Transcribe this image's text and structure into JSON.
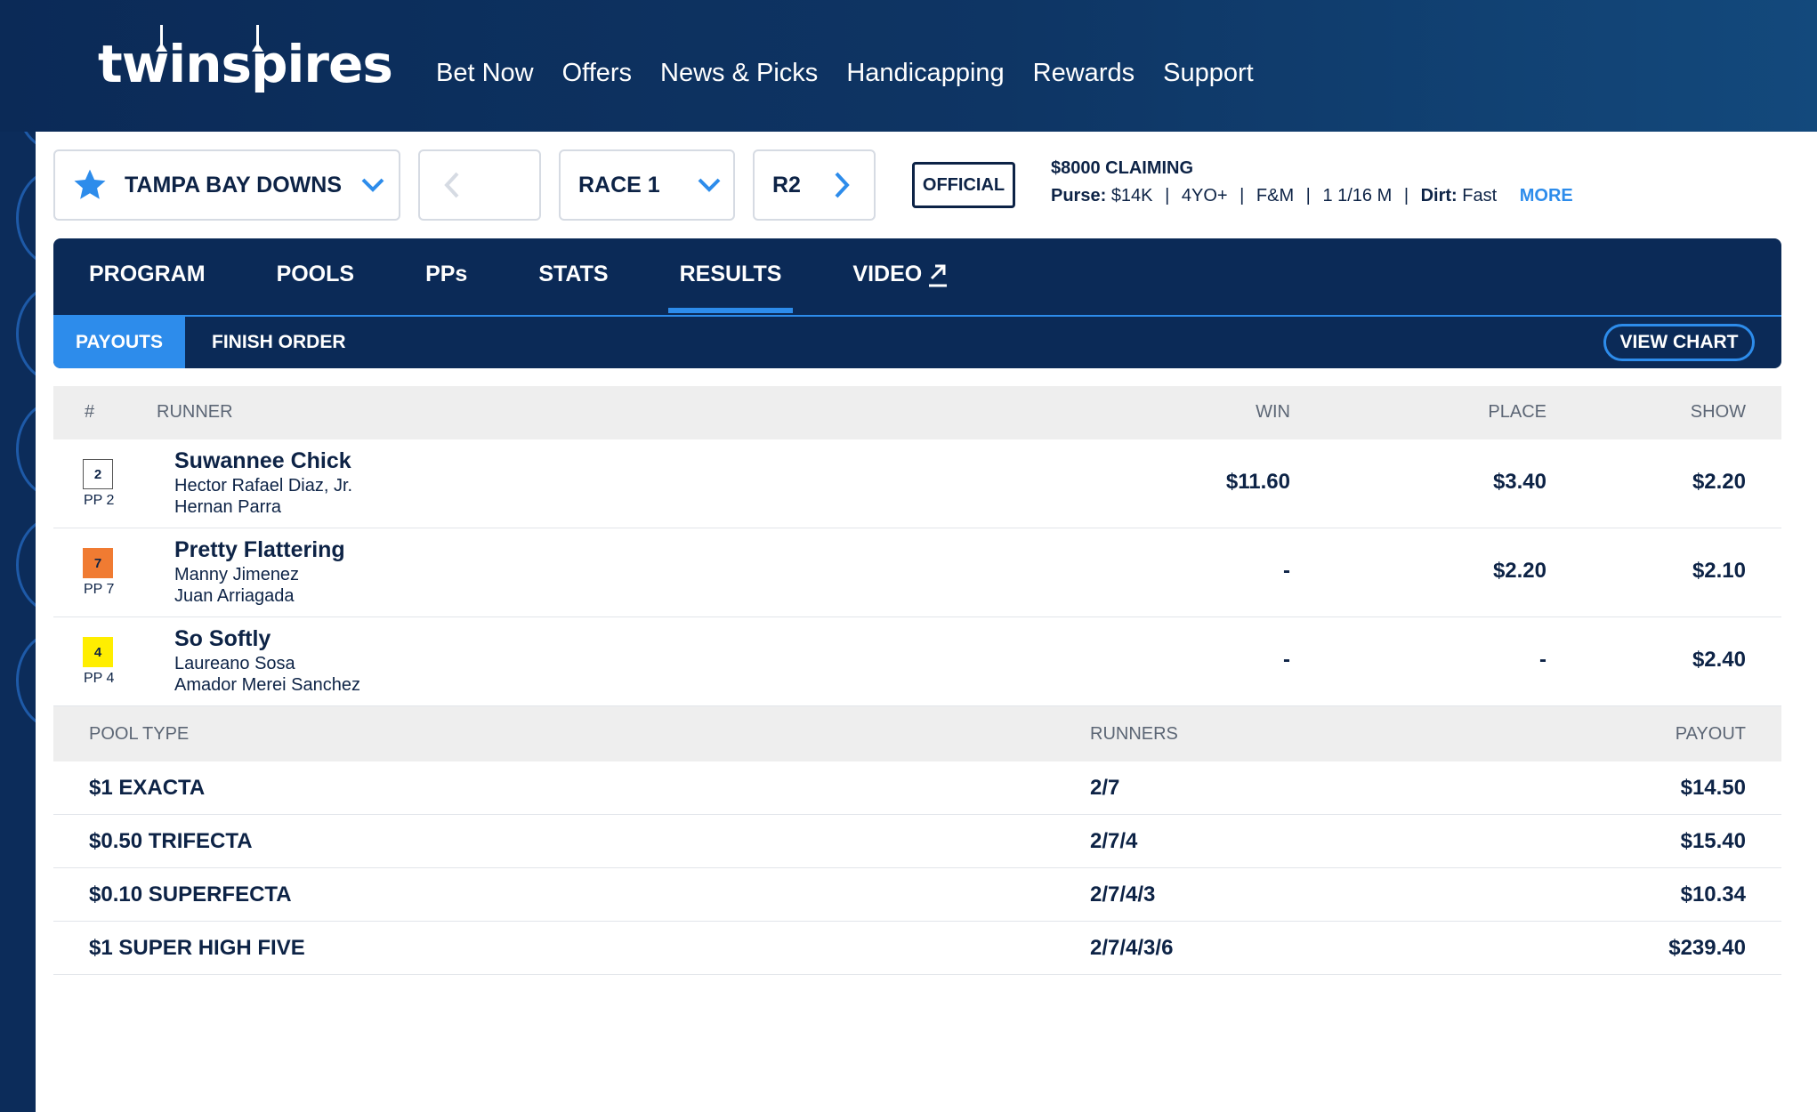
{
  "header": {
    "logo_text": "twinspires",
    "nav": [
      "Bet Now",
      "Offers",
      "News & Picks",
      "Handicapping",
      "Rewards",
      "Support"
    ]
  },
  "race_selector": {
    "track": "TAMPA BAY DOWNS",
    "race": "RACE 1",
    "next_race": "R2",
    "status": "OFFICIAL",
    "race_type": "$8000 CLAIMING",
    "purse_label": "Purse:",
    "purse": "$14K",
    "age": "4YO+",
    "sex": "F&M",
    "distance": "1 1/16 M",
    "surface_label": "Dirt:",
    "condition": "Fast",
    "more": "MORE",
    "separator": "|"
  },
  "tabs": [
    "PROGRAM",
    "POOLS",
    "PPs",
    "STATS",
    "RESULTS",
    "VIDEO"
  ],
  "active_tab": "RESULTS",
  "subtabs": {
    "payouts": "PAYOUTS",
    "finish_order": "FINISH ORDER",
    "view_chart": "VIEW CHART"
  },
  "runners_table": {
    "headers": {
      "num": "#",
      "runner": "RUNNER",
      "win": "WIN",
      "place": "PLACE",
      "show": "SHOW"
    },
    "rows": [
      {
        "pp": "2",
        "pp_label": "PP 2",
        "badge_color": "#ffffff",
        "badge_text": "#0d2346",
        "name": "Suwannee Chick",
        "jockey": "Hector Rafael Diaz, Jr.",
        "trainer": "Hernan Parra",
        "win": "$11.60",
        "place": "$3.40",
        "show": "$2.20"
      },
      {
        "pp": "7",
        "pp_label": "PP 7",
        "badge_color": "#f07b32",
        "badge_text": "#0d2346",
        "name": "Pretty Flattering",
        "jockey": "Manny Jimenez",
        "trainer": "Juan Arriagada",
        "win": "-",
        "place": "$2.20",
        "show": "$2.10"
      },
      {
        "pp": "4",
        "pp_label": "PP 4",
        "badge_color": "#ffee00",
        "badge_text": "#0d2346",
        "name": "So Softly",
        "jockey": "Laureano Sosa",
        "trainer": "Amador Merei Sanchez",
        "win": "-",
        "place": "-",
        "show": "$2.40"
      }
    ]
  },
  "pools_table": {
    "headers": {
      "pool_type": "POOL TYPE",
      "runners": "RUNNERS",
      "payout": "PAYOUT"
    },
    "rows": [
      {
        "pool": "$1 EXACTA",
        "runners": "2/7",
        "payout": "$14.50"
      },
      {
        "pool": "$0.50 TRIFECTA",
        "runners": "2/7/4",
        "payout": "$15.40"
      },
      {
        "pool": "$0.10 SUPERFECTA",
        "runners": "2/7/4/3",
        "payout": "$10.34"
      },
      {
        "pool": "$1 SUPER HIGH FIVE",
        "runners": "2/7/4/3/6",
        "payout": "$239.40"
      }
    ]
  },
  "colors": {
    "navy": "#0b2a57",
    "accent": "#2d8ceb",
    "header_gray": "#eeeeee"
  }
}
